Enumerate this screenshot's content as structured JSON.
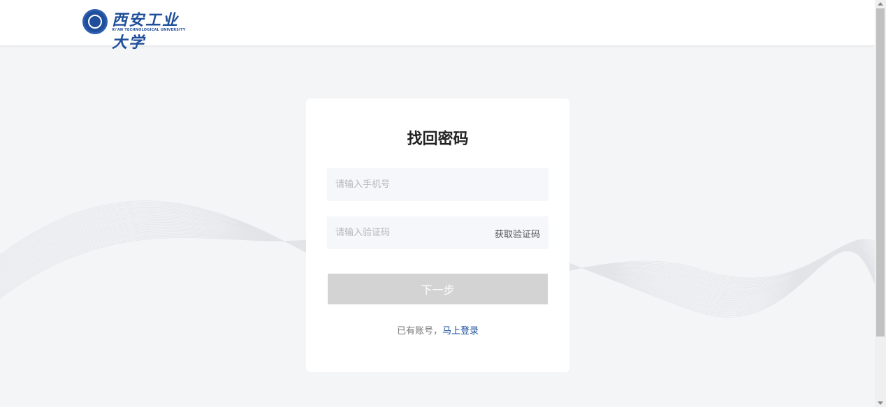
{
  "header": {
    "logo_name": "西安工业大学",
    "logo_en": "XI'AN TECHNOLOGICAL UNIVERSITY"
  },
  "form": {
    "title": "找回密码",
    "phone_placeholder": "请输入手机号",
    "code_placeholder": "请输入验证码",
    "get_code_label": "获取验证码",
    "next_label": "下一步",
    "have_account_text": "已有账号，",
    "login_link_label": "马上登录"
  },
  "colors": {
    "brand": "#1f4e9a",
    "link": "#1a4f9c",
    "button_disabled": "#d3d3d3",
    "input_bg": "#f5f7fa"
  }
}
